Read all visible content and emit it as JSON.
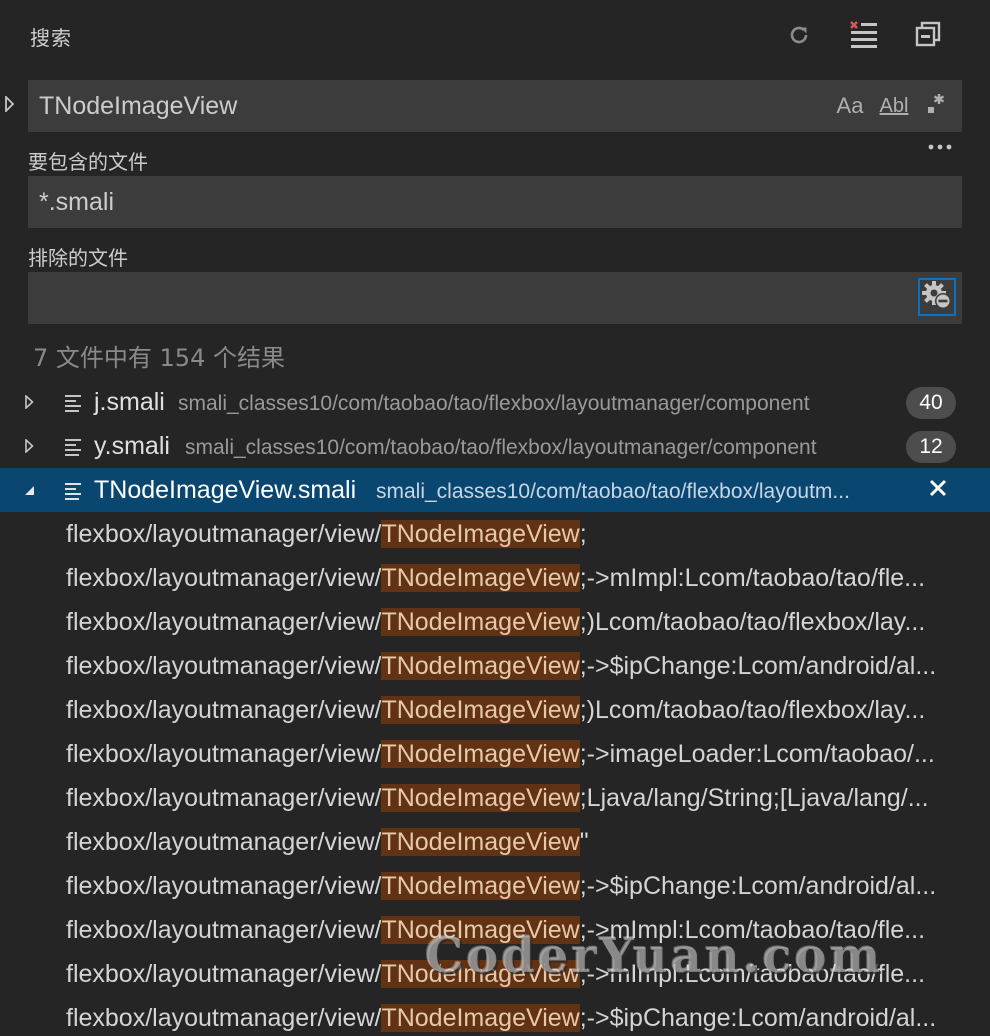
{
  "header": {
    "title": "搜索",
    "refresh_icon": "refresh-icon",
    "clear_icon": "clear-results-icon",
    "collapse_icon": "collapse-all-icon"
  },
  "search": {
    "value": "TNodeImageView",
    "options": {
      "match_case": "Aa",
      "whole_word": "Abl",
      "regex_icon": "regex-icon"
    }
  },
  "include": {
    "label": "要包含的文件",
    "value": "*.smali"
  },
  "exclude": {
    "label": "排除的文件",
    "value": "",
    "settings_icon": "gear-exclude-icon"
  },
  "summary": "7 文件中有 154 个结果",
  "files": [
    {
      "name": "j.smali",
      "path": "smali_classes10/com/taobao/tao/flexbox/layoutmanager/component",
      "count": "40",
      "expanded": false
    },
    {
      "name": "y.smali",
      "path": "smali_classes10/com/taobao/tao/flexbox/layoutmanager/component",
      "count": "12",
      "expanded": false
    },
    {
      "name": "TNodeImageView.smali",
      "path": "smali_classes10/com/taobao/tao/flexbox/layoutm...",
      "count": "",
      "expanded": true
    }
  ],
  "matches": [
    {
      "before": "flexbox/layoutmanager/view/",
      "match": "TNodeImageView",
      "after": ";"
    },
    {
      "before": "flexbox/layoutmanager/view/",
      "match": "TNodeImageView",
      "after": ";->mImpl:Lcom/taobao/tao/fle..."
    },
    {
      "before": "flexbox/layoutmanager/view/",
      "match": "TNodeImageView",
      "after": ";)Lcom/taobao/tao/flexbox/lay..."
    },
    {
      "before": "flexbox/layoutmanager/view/",
      "match": "TNodeImageView",
      "after": ";->$ipChange:Lcom/android/al..."
    },
    {
      "before": "flexbox/layoutmanager/view/",
      "match": "TNodeImageView",
      "after": ";)Lcom/taobao/tao/flexbox/lay..."
    },
    {
      "before": "flexbox/layoutmanager/view/",
      "match": "TNodeImageView",
      "after": ";->imageLoader:Lcom/taobao/..."
    },
    {
      "before": "flexbox/layoutmanager/view/",
      "match": "TNodeImageView",
      "after": ";Ljava/lang/String;[Ljava/lang/..."
    },
    {
      "before": "flexbox/layoutmanager/view/",
      "match": "TNodeImageView",
      "after": "\""
    },
    {
      "before": "flexbox/layoutmanager/view/",
      "match": "TNodeImageView",
      "after": ";->$ipChange:Lcom/android/al..."
    },
    {
      "before": "flexbox/layoutmanager/view/",
      "match": "TNodeImageView",
      "after": ";->mImpl:Lcom/taobao/tao/fle..."
    },
    {
      "before": "flexbox/layoutmanager/view/",
      "match": "TNodeImageView",
      "after": ";->mImpl:Lcom/taobao/tao/fle..."
    },
    {
      "before": "flexbox/layoutmanager/view/",
      "match": "TNodeImageView",
      "after": ";->$ipChange:Lcom/android/al..."
    }
  ],
  "watermark": "CoderYuan.com",
  "colors": {
    "background": "#252526",
    "input_bg": "#3c3c3c",
    "selection": "#094771",
    "match_highlight": "#613214",
    "badge_bg": "#4d4d4d",
    "focus_border": "#0e70c0",
    "clear_accent": "#e05252"
  }
}
